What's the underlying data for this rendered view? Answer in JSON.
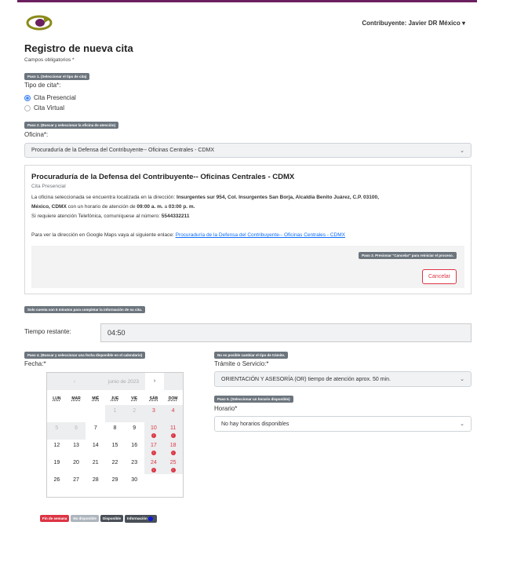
{
  "header": {
    "user": "Contribuyente: Javier DR México"
  },
  "title": "Registro de nueva cita",
  "required_note": "Campos obligatorios *",
  "step1": {
    "badge": "Paso 1. (Seleccionar el tipo de cita)",
    "label": "Tipo de cita*:",
    "options": [
      "Cita Presencial",
      "Cita Virtual"
    ],
    "selected": "Cita Presencial"
  },
  "step2": {
    "badge": "Paso 2. (Buscar y seleccionar la oficina de atención)",
    "label": "Oficina*:",
    "value": "Procuraduría de la Defensa del Contribuyente-- Oficinas Centrales - CDMX"
  },
  "office_card": {
    "title": "Procuraduría de la Defensa del Contribuyente-- Oficinas Centrales - CDMX",
    "subtitle": "Cita Presencial",
    "line1_prefix": "La oficina seleccionada se encuentra localizada en la dirección: ",
    "address_a": "Insurgentes sur 954, Col. Insurgentes San Borja, Alcaldía Benito Juárez, C.P. 03100,",
    "address_b": "México, CDMX",
    "hours_prefix": " con un horario de atención de ",
    "hours_start": "09:00 a. m.",
    "hours_mid": " a ",
    "hours_end": "03:00 p. m.",
    "phone_prefix": "Si requiere atención Telefónica, comuníquese al número: ",
    "phone": "5544332211",
    "maps_prefix": "Para ver la dirección en Google Maps vaya al siguiente enlace: ",
    "maps_link": "Procuraduría de la Defensa del Contribuyente-- Oficinas Centrales - CDMX",
    "step3_badge": "Paso 3. Presionar \"Cancelar\" para reiniciar el proceso.",
    "cancel": "Cancelar"
  },
  "timer": {
    "badge": "Solo cuenta con 5 minutos para completar la información de su cita.",
    "label": "Tiempo restante:",
    "value": "04:50"
  },
  "step4": {
    "badge": "Paso 4. (Buscar y seleccionar una fecha disponible en el calendario)",
    "label": "Fecha:*"
  },
  "calendar": {
    "prev": "‹",
    "month": "junio de 2023",
    "next": "›",
    "dow": [
      "LUN",
      "MAR",
      "MIÉ",
      "JUE",
      "VIE",
      "SÁB",
      "DOM"
    ],
    "days": [
      [
        "",
        "",
        "",
        "1",
        "2",
        "3",
        "4"
      ],
      [
        "5",
        "6",
        "7",
        "8",
        "9",
        "10",
        "11"
      ],
      [
        "12",
        "13",
        "14",
        "15",
        "16",
        "17",
        "18"
      ],
      [
        "19",
        "20",
        "21",
        "22",
        "23",
        "24",
        "25"
      ],
      [
        "26",
        "27",
        "28",
        "29",
        "30",
        "",
        ""
      ]
    ]
  },
  "legend": [
    "Fin de semana",
    "No disponible",
    "Disponible",
    "Información"
  ],
  "service": {
    "badge": "No es posible cambiar el tipo de trámite.",
    "label": "Trámite o Servicio:*",
    "value": "ORIENTACIÓN Y ASESORÍA (OR) tiempo de atención aprox. 50 min."
  },
  "step5": {
    "badge": "Paso 5. (Seleccionar un horario disponible)",
    "label": "Horario*",
    "value": "No hay horarios disponibles"
  },
  "colors": {
    "brand_purple": "#6b1f5f",
    "brand_olive": "#8a8a1a",
    "danger": "#dc3545",
    "badge": "#6c757d"
  }
}
